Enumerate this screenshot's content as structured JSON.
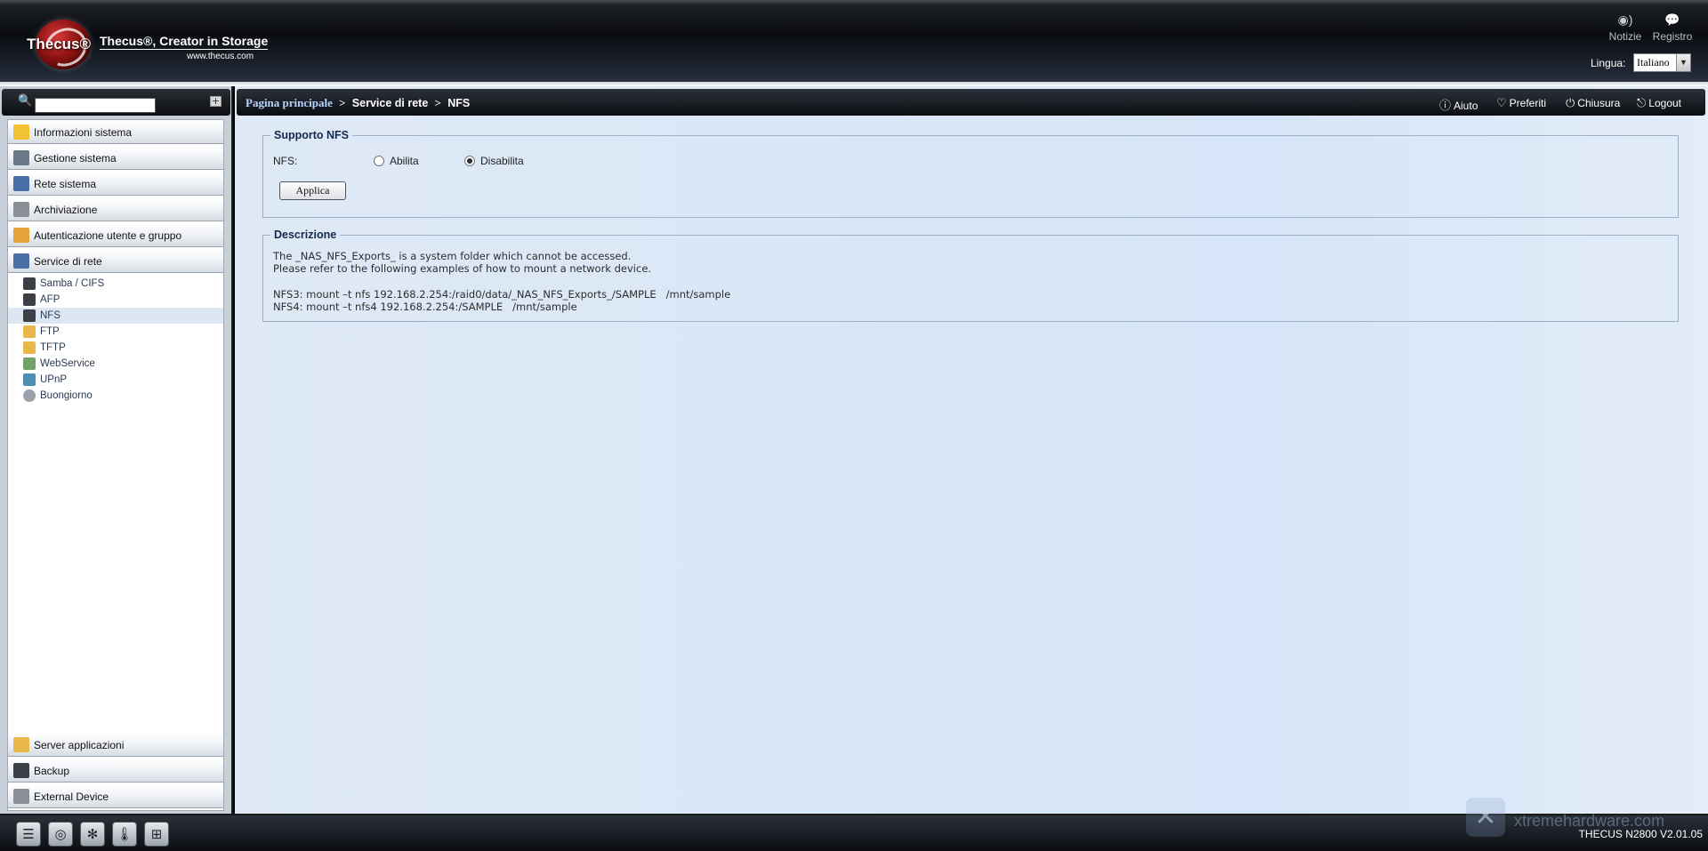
{
  "header": {
    "brand": "Thecus®",
    "tagline": "Thecus®, Creator in Storage",
    "url": "www.thecus.com",
    "notizie_label": "Notizie",
    "registro_label": "Registro",
    "lingua_label": "Lingua:",
    "lingua_value": "Italiano"
  },
  "sidebar": {
    "categories_top": [
      {
        "label": "Informazioni sistema",
        "icon": "info-icon",
        "color": "#f1c232"
      },
      {
        "label": "Gestione sistema",
        "icon": "tools-icon",
        "color": "#6b7a88"
      },
      {
        "label": "Rete sistema",
        "icon": "network-icon",
        "color": "#4a6fa8"
      },
      {
        "label": "Archiviazione",
        "icon": "storage-icon",
        "color": "#8a8f96"
      },
      {
        "label": "Autenticazione utente e gruppo",
        "icon": "users-icon",
        "color": "#e4a23c"
      },
      {
        "label": "Service di rete",
        "icon": "network-service-icon",
        "color": "#4a6fa8"
      }
    ],
    "subitems": [
      {
        "label": "Samba / CIFS",
        "icon": "samba-icon"
      },
      {
        "label": "AFP",
        "icon": "afp-icon"
      },
      {
        "label": "NFS",
        "icon": "nfs-icon"
      },
      {
        "label": "FTP",
        "icon": "ftp-icon"
      },
      {
        "label": "TFTP",
        "icon": "tftp-icon"
      },
      {
        "label": "WebService",
        "icon": "webservice-icon"
      },
      {
        "label": "UPnP",
        "icon": "upnp-icon"
      },
      {
        "label": "Buongiorno",
        "icon": "bonjour-icon"
      }
    ],
    "categories_bottom": [
      {
        "label": "Server applicazioni",
        "icon": "app-server-icon",
        "color": "#e8b84a"
      },
      {
        "label": "Backup",
        "icon": "backup-icon",
        "color": "#3b3f46"
      },
      {
        "label": "External Device",
        "icon": "external-device-icon",
        "color": "#8a8f96"
      }
    ]
  },
  "breadcrumb": {
    "home": "Pagina principale",
    "sep": ">",
    "section": "Service di rete",
    "page": "NFS"
  },
  "actions": {
    "aiuto": "Aiuto",
    "preferiti": "Preferiti",
    "chiusura": "Chiusura",
    "logout": "Logout"
  },
  "nfs_support": {
    "legend": "Supporto NFS",
    "field_label": "NFS:",
    "option_enable": "Abilita",
    "option_disable": "Disabilita",
    "selected": "Disabilita",
    "apply_label": "Applica"
  },
  "description": {
    "legend": "Descrizione",
    "line1": "The _NAS_NFS_Exports_ is a system folder which cannot be accessed.",
    "line2": "Please refer to the following examples of how to mount a network device.",
    "line3": "NFS3: mount –t nfs 192.168.2.254:/raid0/data/_NAS_NFS_Exports_/SAMPLE   /mnt/sample",
    "line4": "NFS4: mount –t nfs4 192.168.2.254:/SAMPLE   /mnt/sample"
  },
  "footer": {
    "version": "THECUS N2800 V2.01.05",
    "watermark": "xtremehardware.com"
  }
}
